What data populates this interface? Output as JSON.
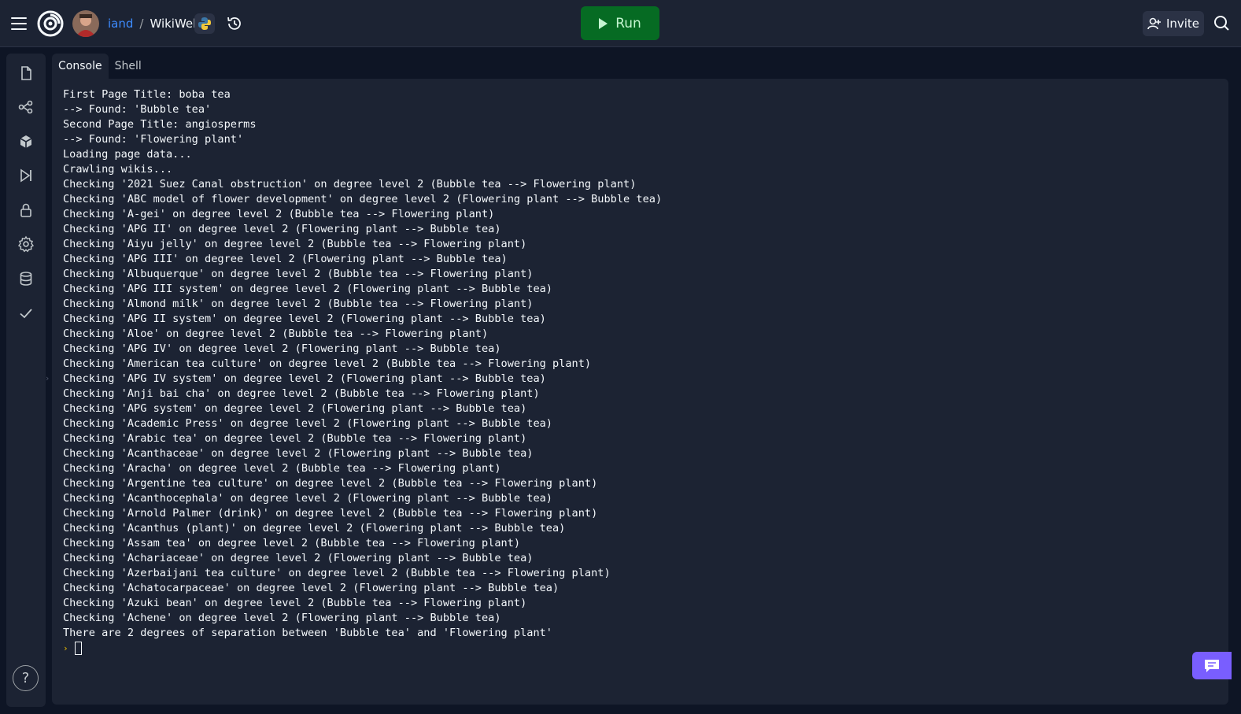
{
  "header": {
    "user": "iand",
    "separator": "/",
    "repl_name": "WikiWeb",
    "run_label": "Run",
    "invite_label": "Invite"
  },
  "tabs": [
    {
      "label": "Console",
      "active": true
    },
    {
      "label": "Shell",
      "active": false
    }
  ],
  "sidebar": {
    "icons": [
      "files-icon",
      "git-icon",
      "packages-icon",
      "debugger-icon",
      "secrets-icon",
      "settings-icon",
      "database-icon",
      "check-icon"
    ],
    "help_label": "?"
  },
  "console": {
    "lines": [
      "First Page Title: boba tea",
      "--> Found: 'Bubble tea'",
      "Second Page Title: angiosperms",
      "--> Found: 'Flowering plant'",
      "Loading page data...",
      "Crawling wikis...",
      "Checking '2021 Suez Canal obstruction' on degree level 2 (Bubble tea --> Flowering plant)",
      "Checking 'ABC model of flower development' on degree level 2 (Flowering plant --> Bubble tea)",
      "Checking 'A-gei' on degree level 2 (Bubble tea --> Flowering plant)",
      "Checking 'APG II' on degree level 2 (Flowering plant --> Bubble tea)",
      "Checking 'Aiyu jelly' on degree level 2 (Bubble tea --> Flowering plant)",
      "Checking 'APG III' on degree level 2 (Flowering plant --> Bubble tea)",
      "Checking 'Albuquerque' on degree level 2 (Bubble tea --> Flowering plant)",
      "Checking 'APG III system' on degree level 2 (Flowering plant --> Bubble tea)",
      "Checking 'Almond milk' on degree level 2 (Bubble tea --> Flowering plant)",
      "Checking 'APG II system' on degree level 2 (Flowering plant --> Bubble tea)",
      "Checking 'Aloe' on degree level 2 (Bubble tea --> Flowering plant)",
      "Checking 'APG IV' on degree level 2 (Flowering plant --> Bubble tea)",
      "Checking 'American tea culture' on degree level 2 (Bubble tea --> Flowering plant)",
      "Checking 'APG IV system' on degree level 2 (Flowering plant --> Bubble tea)",
      "Checking 'Anji bai cha' on degree level 2 (Bubble tea --> Flowering plant)",
      "Checking 'APG system' on degree level 2 (Flowering plant --> Bubble tea)",
      "Checking 'Academic Press' on degree level 2 (Flowering plant --> Bubble tea)",
      "Checking 'Arabic tea' on degree level 2 (Bubble tea --> Flowering plant)",
      "Checking 'Acanthaceae' on degree level 2 (Flowering plant --> Bubble tea)",
      "Checking 'Aracha' on degree level 2 (Bubble tea --> Flowering plant)",
      "Checking 'Argentine tea culture' on degree level 2 (Bubble tea --> Flowering plant)",
      "Checking 'Acanthocephala' on degree level 2 (Flowering plant --> Bubble tea)",
      "Checking 'Arnold Palmer (drink)' on degree level 2 (Bubble tea --> Flowering plant)",
      "Checking 'Acanthus (plant)' on degree level 2 (Flowering plant --> Bubble tea)",
      "Checking 'Assam tea' on degree level 2 (Bubble tea --> Flowering plant)",
      "Checking 'Achariaceae' on degree level 2 (Flowering plant --> Bubble tea)",
      "Checking 'Azerbaijani tea culture' on degree level 2 (Bubble tea --> Flowering plant)",
      "Checking 'Achatocarpaceae' on degree level 2 (Flowering plant --> Bubble tea)",
      "Checking 'Azuki bean' on degree level 2 (Bubble tea --> Flowering plant)",
      "Checking 'Achene' on degree level 2 (Flowering plant --> Bubble tea)",
      "There are 2 degrees of separation between 'Bubble tea' and 'Flowering plant'"
    ],
    "prompt_symbol": "›"
  },
  "colors": {
    "background": "#0e1525",
    "panel": "#1c2333",
    "run_button": "#066b23",
    "link": "#3d8bff",
    "chat_button": "#795eff"
  }
}
